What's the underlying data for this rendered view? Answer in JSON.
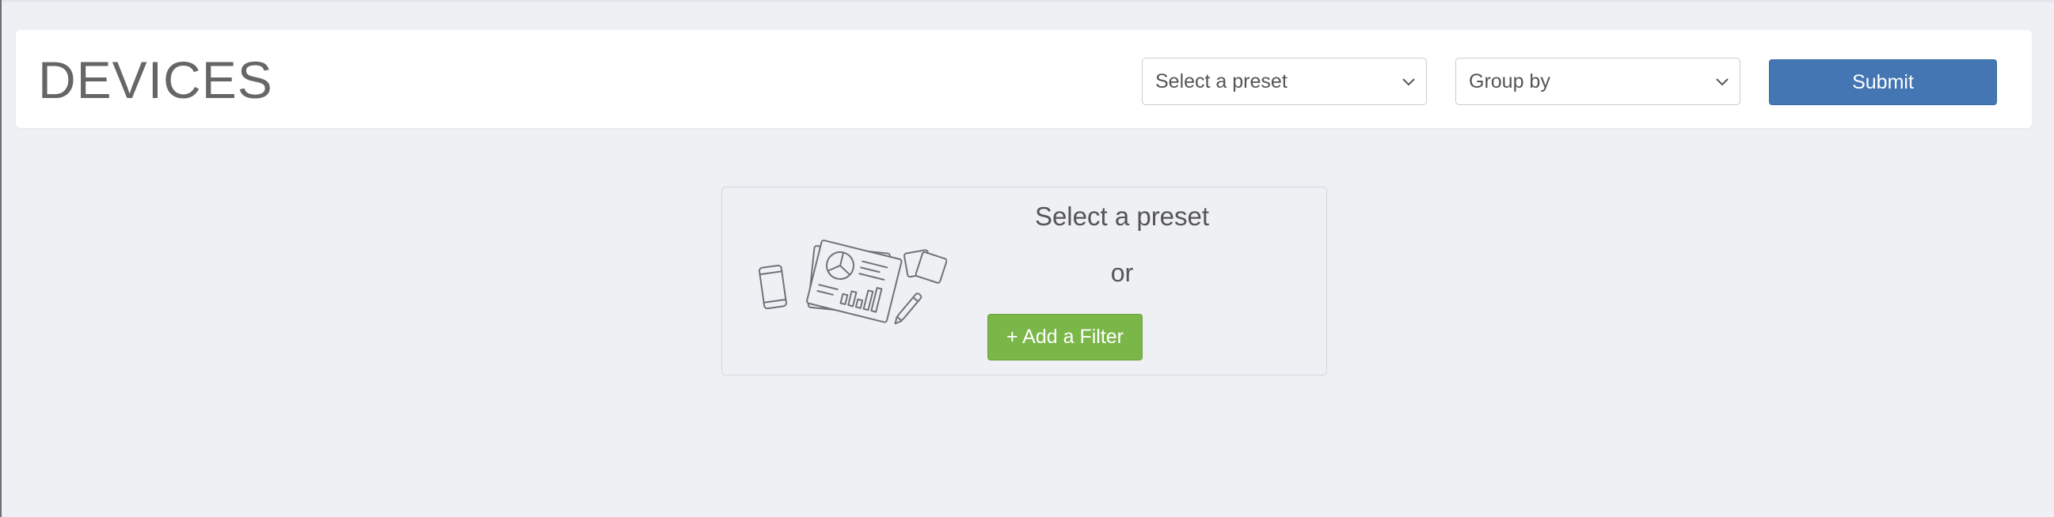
{
  "header": {
    "title": "DEVICES",
    "preset_select": {
      "selected": "Select a preset"
    },
    "group_select": {
      "selected": "Group by"
    },
    "submit_label": "Submit"
  },
  "empty_state": {
    "title": "Select a preset",
    "or_text": "or",
    "add_filter_label": "+ Add a Filter",
    "illustration_icon": "dashboard-reports-illustration-icon"
  },
  "colors": {
    "background": "#eef0f4",
    "submit_button": "#4376b3",
    "add_filter_button": "#7ab648",
    "title_text": "#666666"
  }
}
